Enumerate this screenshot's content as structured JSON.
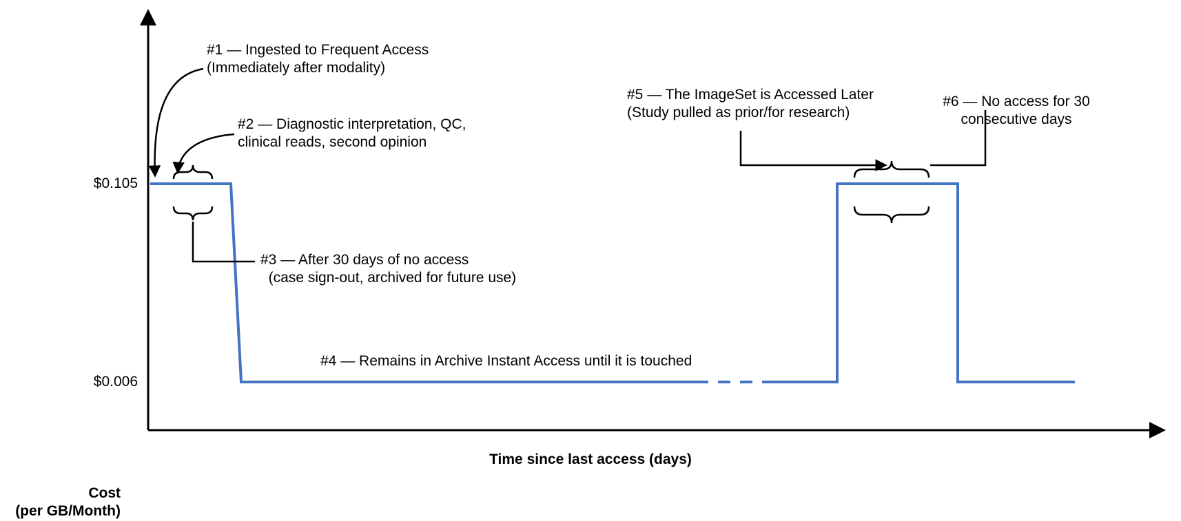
{
  "chart_data": {
    "type": "line",
    "title": "",
    "xlabel": "Time since last access (days)",
    "ylabel": "Cost\n(per GB/Month)",
    "y_ticks": [
      "$0.105",
      "$0.006"
    ],
    "y_values": [
      0.105,
      0.006
    ],
    "high_cost": 0.105,
    "low_cost": 0.006,
    "series": [
      {
        "name": "cost-per-gb-month",
        "segments": [
          {
            "state": "frequent-access",
            "cost": 0.105,
            "start_day": 0,
            "end_day": 30
          },
          {
            "state": "archive-instant-access",
            "cost": 0.006,
            "start_day": 30,
            "end_day": "..."
          },
          {
            "state": "frequent-access",
            "cost": 0.105,
            "start_day": "access_event",
            "end_day": "access_event+30"
          },
          {
            "state": "archive-instant-access",
            "cost": 0.006,
            "start_day": "access_event+30",
            "end_day": "..."
          }
        ]
      }
    ],
    "annotations": [
      {
        "id": 1,
        "title": "#1 — Ingested to Frequent Access",
        "sub": "(Immediately after modality)"
      },
      {
        "id": 2,
        "title": "#2 — Diagnostic interpretation, QC,",
        "sub": "clinical reads, second opinion"
      },
      {
        "id": 3,
        "title": "#3 — After 30 days of no access",
        "sub": "(case sign-out, archived for future use)"
      },
      {
        "id": 4,
        "title": "#4 — Remains in Archive Instant Access until it is touched",
        "sub": ""
      },
      {
        "id": 5,
        "title": "#5 — The ImageSet is Accessed Later",
        "sub": "(Study pulled as prior/for research)"
      },
      {
        "id": 6,
        "title": "#6 — No access for 30",
        "sub": "consecutive days"
      }
    ]
  },
  "colors": {
    "data_line": "#4472C4",
    "axis": "#000000"
  }
}
